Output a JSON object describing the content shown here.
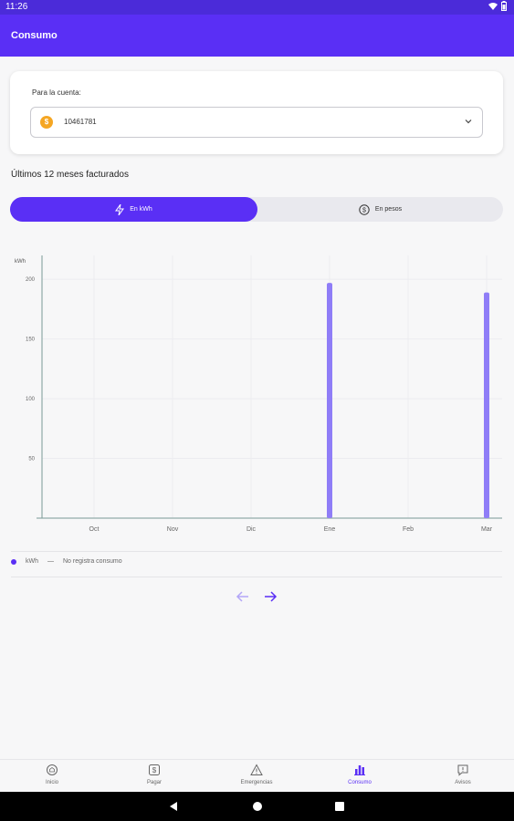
{
  "status": {
    "time": "11:26"
  },
  "appbar": {
    "title": "Consumo"
  },
  "account": {
    "label": "Para la cuenta:",
    "coin_symbol": "$",
    "value": "10461781"
  },
  "section": {
    "title": "Últimos 12 meses facturados"
  },
  "toggle": {
    "kwh_label": "En kWh",
    "pesos_label": "En pesos"
  },
  "chart_data": {
    "type": "bar",
    "ylabel": "kWh",
    "categories": [
      "Oct",
      "Nov",
      "Dic",
      "Ene",
      "Feb",
      "Mar"
    ],
    "values": [
      0,
      0,
      0,
      197,
      0,
      189
    ],
    "yticks": [
      50,
      100,
      150,
      200
    ],
    "ylim": [
      0,
      220
    ],
    "bar_color": "#8f7df7"
  },
  "legend": {
    "kwh": "kWh",
    "no_data": "No registra consumo"
  },
  "nav": {
    "items": [
      {
        "label": "Inicio"
      },
      {
        "label": "Pagar"
      },
      {
        "label": "Emergencias"
      },
      {
        "label": "Consumo"
      },
      {
        "label": "Avisos"
      }
    ]
  },
  "colors": {
    "primary": "#5a2ff5",
    "bar": "#8f7df7"
  }
}
